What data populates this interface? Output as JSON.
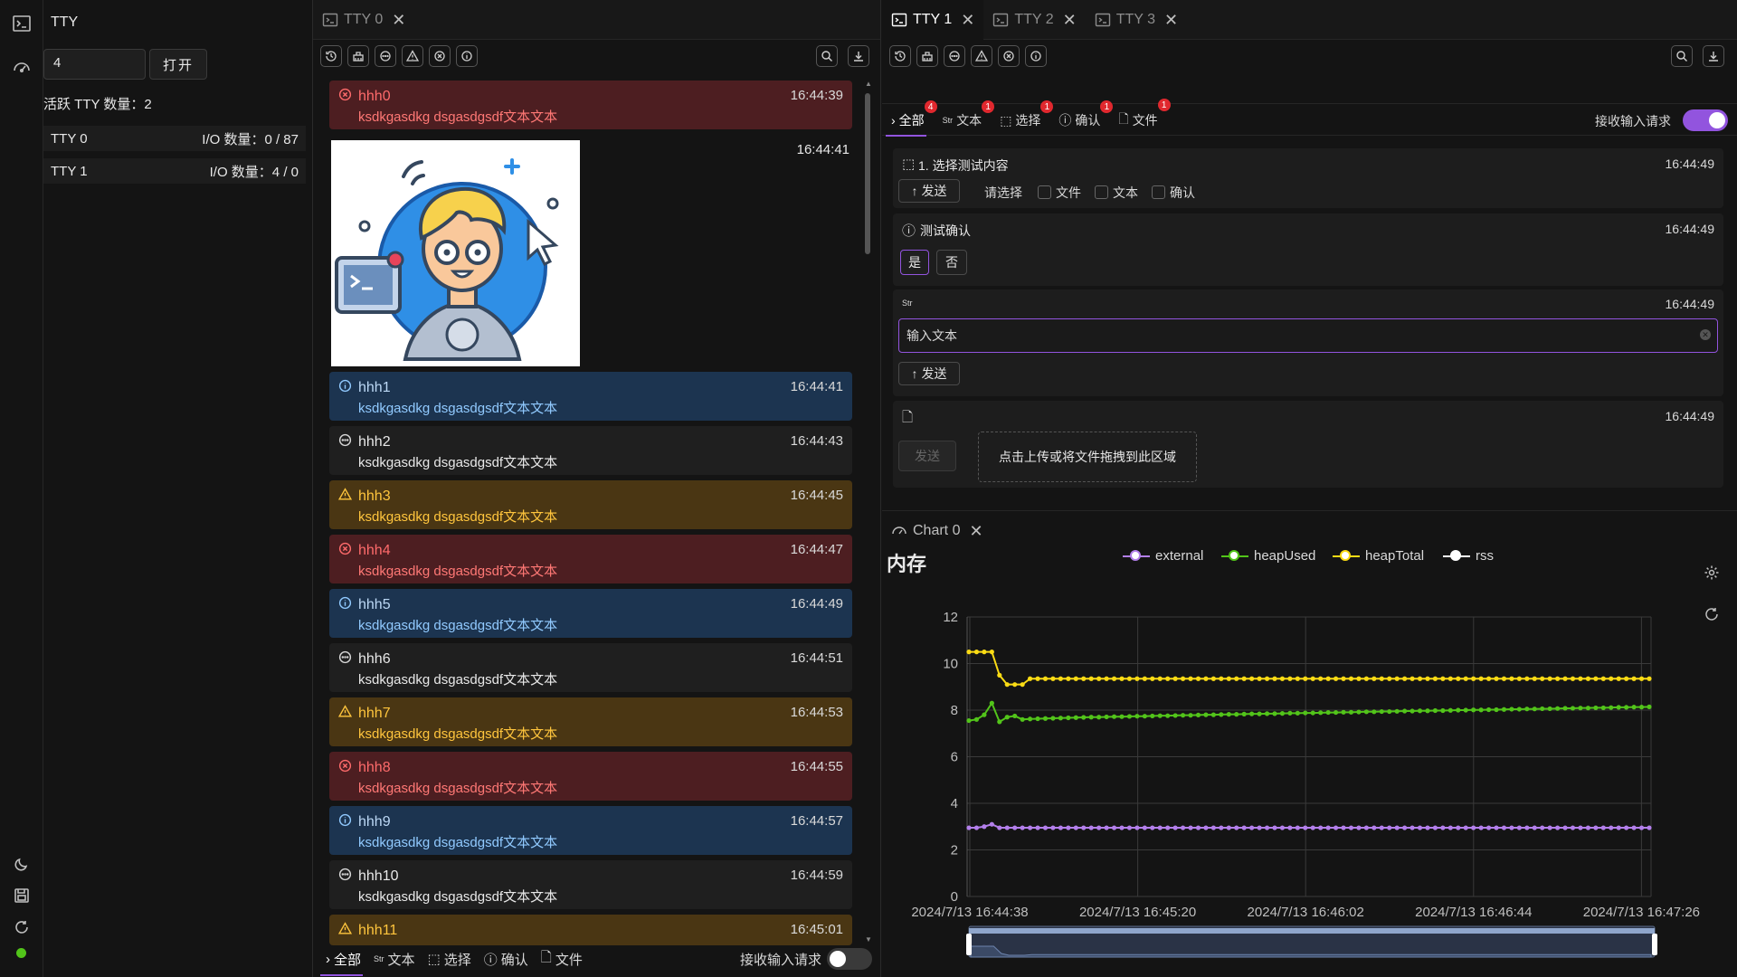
{
  "sidebar": {
    "title": "TTY",
    "input_value": "4",
    "open_label": "打开",
    "active_count_label": "活跃 TTY 数量：2",
    "ttys": [
      {
        "name": "TTY 0",
        "io": "I/O 数量：0 / 87"
      },
      {
        "name": "TTY 1",
        "io": "I/O 数量：4 / 0"
      }
    ]
  },
  "left_column": {
    "tabs": [
      {
        "label": "TTY 0",
        "active": false
      }
    ],
    "image_time": "16:44:41",
    "messages": [
      {
        "kind": "error",
        "title": "hhh0",
        "body": "ksdkgasdkg dsgasdgsdf文本文本",
        "time": "16:44:39"
      },
      {
        "kind": "info",
        "title": "hhh1",
        "body": "ksdkgasdkg dsgasdgsdf文本文本",
        "time": "16:44:41"
      },
      {
        "kind": "normal",
        "title": "hhh2",
        "body": "ksdkgasdkg dsgasdgsdf文本文本",
        "time": "16:44:43"
      },
      {
        "kind": "warn",
        "title": "hhh3",
        "body": "ksdkgasdkg dsgasdgsdf文本文本",
        "time": "16:44:45"
      },
      {
        "kind": "error",
        "title": "hhh4",
        "body": "ksdkgasdkg dsgasdgsdf文本文本",
        "time": "16:44:47"
      },
      {
        "kind": "info",
        "title": "hhh5",
        "body": "ksdkgasdkg dsgasdgsdf文本文本",
        "time": "16:44:49"
      },
      {
        "kind": "normal",
        "title": "hhh6",
        "body": "ksdkgasdkg dsgasdgsdf文本文本",
        "time": "16:44:51"
      },
      {
        "kind": "warn",
        "title": "hhh7",
        "body": "ksdkgasdkg dsgasdgsdf文本文本",
        "time": "16:44:53"
      },
      {
        "kind": "error",
        "title": "hhh8",
        "body": "ksdkgasdkg dsgasdgsdf文本文本",
        "time": "16:44:55"
      },
      {
        "kind": "info",
        "title": "hhh9",
        "body": "ksdkgasdkg dsgasdgsdf文本文本",
        "time": "16:44:57"
      },
      {
        "kind": "normal",
        "title": "hhh10",
        "body": "ksdkgasdkg dsgasdgsdf文本文本",
        "time": "16:44:59"
      },
      {
        "kind": "warn",
        "title": "hhh11",
        "body": "",
        "time": "16:45:01"
      }
    ],
    "filters": {
      "all": "全部",
      "text": "文本",
      "select": "选择",
      "confirm": "确认",
      "file": "文件",
      "str_tag": "Str"
    },
    "accept_label": "接收输入请求",
    "accept_on": false
  },
  "right_column": {
    "tabs": [
      {
        "label": "TTY 1",
        "active": true
      },
      {
        "label": "TTY 2",
        "active": false
      },
      {
        "label": "TTY 3",
        "active": false
      }
    ],
    "filters": {
      "all": "全部",
      "text": "文本",
      "select": "选择",
      "confirm": "确认",
      "file": "文件",
      "str_tag": "Str"
    },
    "badges": {
      "all": "4",
      "text": "1",
      "select": "1",
      "confirm": "1",
      "file": "1"
    },
    "accept_label": "接收输入请求",
    "accept_on": true,
    "select_card": {
      "title": "1. 选择测试内容",
      "time": "16:44:49",
      "send": "发送",
      "prompt": "请选择",
      "options": [
        "文件",
        "文本",
        "确认"
      ]
    },
    "confirm_card": {
      "title": "测试确认",
      "time": "16:44:49",
      "yes": "是",
      "no": "否"
    },
    "text_card": {
      "tag": "Str",
      "time": "16:44:49",
      "placeholder": "输入文本",
      "send": "发送"
    },
    "file_card": {
      "time": "16:44:49",
      "send": "发送",
      "drop_label": "点击上传或将文件拖拽到此区域"
    }
  },
  "chart_panel": {
    "tab_label": "Chart 0",
    "colors": {
      "external": "#b37feb",
      "heapUsed": "#52c41a",
      "heapTotal": "#fadb14",
      "rss": "#ffffff"
    }
  },
  "chart_data": {
    "type": "line",
    "title": "内存",
    "legend": [
      "external",
      "heapUsed",
      "heapTotal",
      "rss"
    ],
    "legend_position": "top",
    "xlabels": [
      "2024/7/13 16:44:38",
      "2024/7/13 16:45:20",
      "2024/7/13 16:46:02",
      "2024/7/13 16:46:44",
      "2024/7/13 16:47:26"
    ],
    "ylim": [
      0,
      12
    ],
    "yticks": [
      0,
      2,
      4,
      6,
      8,
      10,
      12
    ],
    "grid": true,
    "num_points": 90,
    "series": [
      {
        "name": "external",
        "color": "#b37feb",
        "values": [
          2.95,
          2.95,
          3.0,
          3.1,
          2.95,
          2.95,
          2.95,
          2.95,
          2.95,
          2.95,
          2.95,
          2.95,
          2.95,
          2.95,
          2.95,
          2.95,
          2.95,
          2.95,
          2.95,
          2.95,
          2.95,
          2.95,
          2.95,
          2.95,
          2.95,
          2.95,
          2.95,
          2.95,
          2.95,
          2.95,
          2.95,
          2.95,
          2.95,
          2.95,
          2.95,
          2.95,
          2.95,
          2.95,
          2.95,
          2.95,
          2.95,
          2.95,
          2.95,
          2.95,
          2.95,
          2.95,
          2.95,
          2.95,
          2.95,
          2.95,
          2.95,
          2.95,
          2.95,
          2.95,
          2.95,
          2.95,
          2.95,
          2.95,
          2.95,
          2.95,
          2.95,
          2.95,
          2.95,
          2.95,
          2.95,
          2.95,
          2.95,
          2.95,
          2.95,
          2.95,
          2.95,
          2.95,
          2.95,
          2.95,
          2.95,
          2.95,
          2.95,
          2.95,
          2.95,
          2.95,
          2.95,
          2.95,
          2.95,
          2.95,
          2.95,
          2.95,
          2.95,
          2.95,
          2.95,
          2.95
        ]
      },
      {
        "name": "heapUsed",
        "color": "#52c41a",
        "values": [
          7.55,
          7.6,
          7.8,
          8.3,
          7.5,
          7.7,
          7.75,
          7.6,
          7.62,
          7.63,
          7.64,
          7.65,
          7.66,
          7.67,
          7.68,
          7.69,
          7.7,
          7.7,
          7.71,
          7.72,
          7.72,
          7.73,
          7.74,
          7.74,
          7.75,
          7.76,
          7.76,
          7.77,
          7.78,
          7.78,
          7.79,
          7.8,
          7.8,
          7.81,
          7.82,
          7.82,
          7.83,
          7.84,
          7.84,
          7.85,
          7.85,
          7.86,
          7.87,
          7.87,
          7.88,
          7.88,
          7.89,
          7.9,
          7.9,
          7.91,
          7.91,
          7.92,
          7.93,
          7.93,
          7.94,
          7.94,
          7.95,
          7.96,
          7.96,
          7.97,
          7.97,
          7.98,
          7.98,
          7.99,
          8.0,
          8.0,
          8.01,
          8.01,
          8.02,
          8.02,
          8.03,
          8.04,
          8.04,
          8.05,
          8.05,
          8.06,
          8.06,
          8.07,
          8.08,
          8.08,
          8.09,
          8.09,
          8.1,
          8.1,
          8.11,
          8.12,
          8.12,
          8.13,
          8.13,
          8.14
        ]
      },
      {
        "name": "heapTotal",
        "color": "#fadb14",
        "values": [
          10.5,
          10.5,
          10.5,
          10.5,
          9.5,
          9.1,
          9.1,
          9.1,
          9.35,
          9.35,
          9.35,
          9.35,
          9.35,
          9.35,
          9.35,
          9.35,
          9.35,
          9.35,
          9.35,
          9.35,
          9.35,
          9.35,
          9.35,
          9.35,
          9.35,
          9.35,
          9.35,
          9.35,
          9.35,
          9.35,
          9.35,
          9.35,
          9.35,
          9.35,
          9.35,
          9.35,
          9.35,
          9.35,
          9.35,
          9.35,
          9.35,
          9.35,
          9.35,
          9.35,
          9.35,
          9.35,
          9.35,
          9.35,
          9.35,
          9.35,
          9.35,
          9.35,
          9.35,
          9.35,
          9.35,
          9.35,
          9.35,
          9.35,
          9.35,
          9.35,
          9.35,
          9.35,
          9.35,
          9.35,
          9.35,
          9.35,
          9.35,
          9.35,
          9.35,
          9.35,
          9.35,
          9.35,
          9.35,
          9.35,
          9.35,
          9.35,
          9.35,
          9.35,
          9.35,
          9.35,
          9.35,
          9.35,
          9.35,
          9.35,
          9.35,
          9.35,
          9.35,
          9.35,
          9.35,
          9.35
        ]
      },
      {
        "name": "rss",
        "color": "#ffffff",
        "values": []
      }
    ]
  }
}
